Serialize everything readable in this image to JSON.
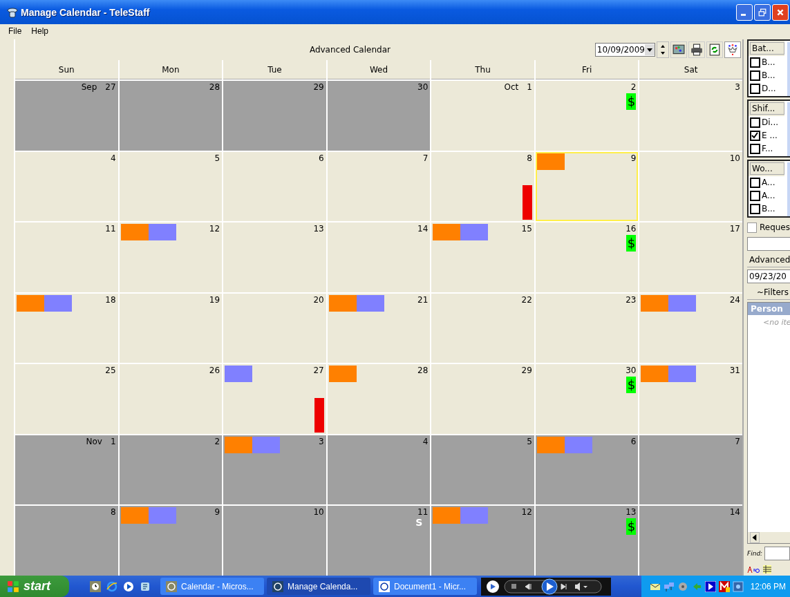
{
  "window": {
    "title": "Manage Calendar - TeleStaff"
  },
  "menu": [
    "File",
    "Help"
  ],
  "calendar": {
    "title": "Advanced Calendar",
    "date": "10/09/2009",
    "weekdays": [
      "Sun",
      "Mon",
      "Tue",
      "Wed",
      "Thu",
      "Fri",
      "Sat"
    ],
    "weeks": [
      [
        {
          "month": "Sep",
          "day": "27",
          "current": false,
          "selected": false
        },
        {
          "day": "28",
          "current": false,
          "selected": false
        },
        {
          "day": "29",
          "current": false,
          "selected": false
        },
        {
          "day": "30",
          "current": false,
          "selected": false
        },
        {
          "month": "Oct",
          "day": "1",
          "current": true,
          "selected": false
        },
        {
          "day": "2",
          "current": true,
          "selected": false,
          "badge": "$"
        },
        {
          "day": "3",
          "current": true,
          "selected": false
        }
      ],
      [
        {
          "day": "4",
          "current": true,
          "selected": false
        },
        {
          "day": "5",
          "current": true,
          "selected": false
        },
        {
          "day": "6",
          "current": true,
          "selected": false
        },
        {
          "day": "7",
          "current": true,
          "selected": false
        },
        {
          "day": "8",
          "current": true,
          "selected": false,
          "flag": true
        },
        {
          "day": "9",
          "current": true,
          "selected": true,
          "events": [
            {
              "color": "#ff8000"
            }
          ]
        },
        {
          "day": "10",
          "current": true,
          "selected": false
        }
      ],
      [
        {
          "day": "11",
          "current": true,
          "selected": false
        },
        {
          "day": "12",
          "current": true,
          "selected": false,
          "events": [
            {
              "color": "#ff8000"
            },
            {
              "color": "#8080ff"
            }
          ]
        },
        {
          "day": "13",
          "current": true,
          "selected": false
        },
        {
          "day": "14",
          "current": true,
          "selected": false
        },
        {
          "day": "15",
          "current": true,
          "selected": false,
          "events": [
            {
              "color": "#ff8000"
            },
            {
              "color": "#8080ff"
            }
          ]
        },
        {
          "day": "16",
          "current": true,
          "selected": false,
          "badge": "$"
        },
        {
          "day": "17",
          "current": true,
          "selected": false
        }
      ],
      [
        {
          "day": "18",
          "current": true,
          "selected": false,
          "events": [
            {
              "color": "#ff8000"
            },
            {
              "color": "#8080ff"
            }
          ]
        },
        {
          "day": "19",
          "current": true,
          "selected": false
        },
        {
          "day": "20",
          "current": true,
          "selected": false
        },
        {
          "day": "21",
          "current": true,
          "selected": false,
          "events": [
            {
              "color": "#ff8000"
            },
            {
              "color": "#8080ff"
            }
          ]
        },
        {
          "day": "22",
          "current": true,
          "selected": false
        },
        {
          "day": "23",
          "current": true,
          "selected": false
        },
        {
          "day": "24",
          "current": true,
          "selected": false,
          "events": [
            {
              "color": "#ff8000"
            },
            {
              "color": "#8080ff"
            }
          ]
        }
      ],
      [
        {
          "day": "25",
          "current": true,
          "selected": false
        },
        {
          "day": "26",
          "current": true,
          "selected": false
        },
        {
          "day": "27",
          "current": true,
          "selected": false,
          "events": [
            {
              "color": "#8080ff"
            }
          ],
          "flag": true
        },
        {
          "day": "28",
          "current": true,
          "selected": false,
          "events": [
            {
              "color": "#ff8000"
            }
          ]
        },
        {
          "day": "29",
          "current": true,
          "selected": false
        },
        {
          "day": "30",
          "current": true,
          "selected": false,
          "badge": "$"
        },
        {
          "day": "31",
          "current": true,
          "selected": false,
          "events": [
            {
              "color": "#ff8000"
            },
            {
              "color": "#8080ff"
            }
          ]
        }
      ],
      [
        {
          "month": "Nov",
          "day": "1",
          "current": false,
          "selected": false
        },
        {
          "day": "2",
          "current": false,
          "selected": false
        },
        {
          "day": "3",
          "current": false,
          "selected": false,
          "events": [
            {
              "color": "#ff8000"
            },
            {
              "color": "#8080ff"
            }
          ]
        },
        {
          "day": "4",
          "current": false,
          "selected": false
        },
        {
          "day": "5",
          "current": false,
          "selected": false
        },
        {
          "day": "6",
          "current": false,
          "selected": false,
          "events": [
            {
              "color": "#ff8000"
            },
            {
              "color": "#8080ff"
            }
          ]
        },
        {
          "day": "7",
          "current": false,
          "selected": false
        }
      ],
      [
        {
          "day": "8",
          "current": false,
          "selected": false
        },
        {
          "day": "9",
          "current": false,
          "selected": false,
          "events": [
            {
              "color": "#ff8000"
            },
            {
              "color": "#8080ff"
            }
          ]
        },
        {
          "day": "10",
          "current": false,
          "selected": false
        },
        {
          "day": "11",
          "current": false,
          "selected": false,
          "note": "S"
        },
        {
          "day": "12",
          "current": false,
          "selected": false,
          "events": [
            {
              "color": "#ff8000"
            },
            {
              "color": "#8080ff"
            }
          ]
        },
        {
          "day": "13",
          "current": false,
          "selected": false,
          "badge": "$"
        },
        {
          "day": "14",
          "current": false,
          "selected": false
        }
      ]
    ]
  },
  "side_panel": {
    "lists": [
      {
        "header": "Bat...",
        "items": [
          {
            "label": "B...",
            "checked": false
          },
          {
            "label": "B...",
            "checked": false
          },
          {
            "label": "D...",
            "checked": false
          }
        ]
      },
      {
        "header": "Shif...",
        "items": [
          {
            "label": "Di...",
            "checked": false
          },
          {
            "label": "E ...",
            "checked": true
          },
          {
            "label": "F...",
            "checked": false
          }
        ]
      },
      {
        "header": "Wo...",
        "items": [
          {
            "label": "A...",
            "checked": false
          },
          {
            "label": "A...",
            "checked": false
          },
          {
            "label": "B...",
            "checked": false
          }
        ]
      }
    ],
    "request": {
      "label": "Reques",
      "checked": false
    },
    "advanced_button": "Advanced",
    "date_field": "09/23/20",
    "filters_button": "~Filters",
    "list_header": "Person",
    "empty_text": "<no ite",
    "find_label": "Find:"
  },
  "taskbar": {
    "start": "start",
    "tasks": [
      {
        "label": "Calendar - Micros...",
        "selected": false
      },
      {
        "label": "Manage Calenda...",
        "selected": true
      },
      {
        "label": "Document1 - Micr...",
        "selected": false
      }
    ],
    "clock": "12:06 PM"
  }
}
